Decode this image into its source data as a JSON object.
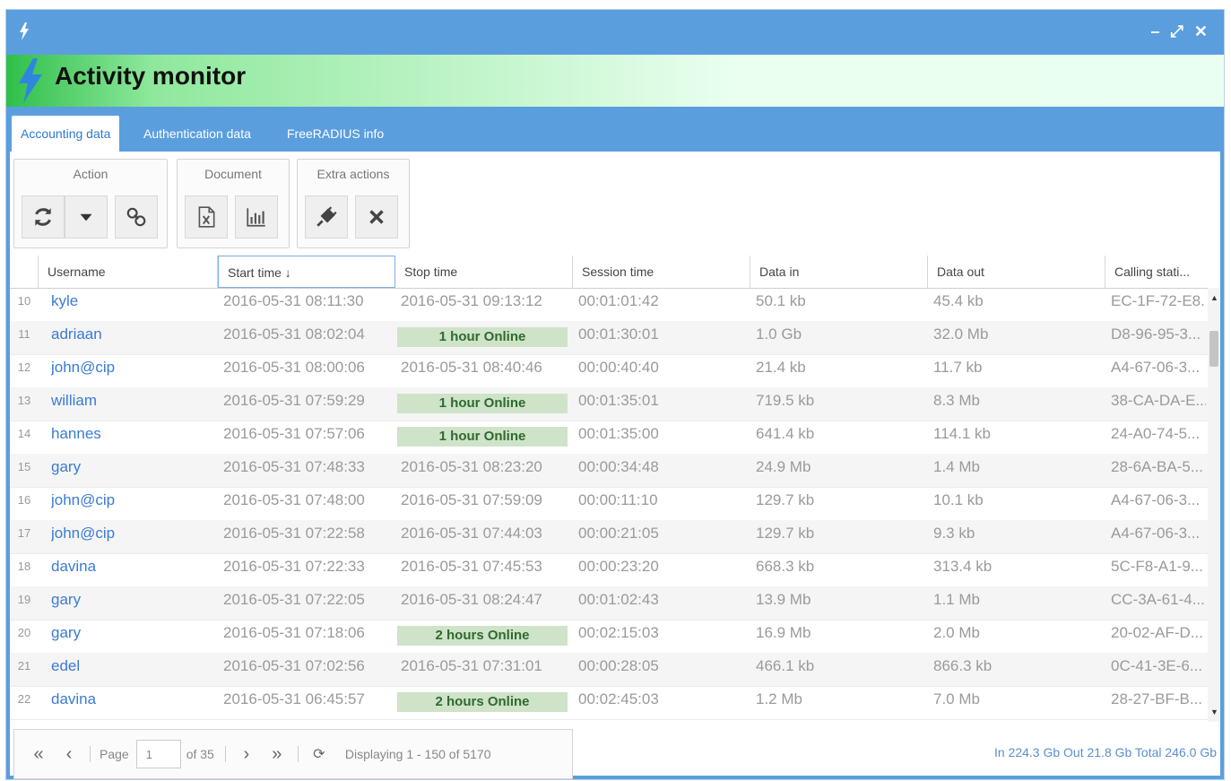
{
  "window": {
    "title": "Activity monitor",
    "controls": [
      "–",
      "⤢",
      "✕"
    ]
  },
  "tabs": [
    {
      "label": "Accounting data",
      "active": true
    },
    {
      "label": "Authentication data",
      "active": false
    },
    {
      "label": "FreeRADIUS info",
      "active": false
    }
  ],
  "toolbar": {
    "action_label": "Action",
    "document_label": "Document",
    "extra_label": "Extra actions"
  },
  "columns": [
    "Username",
    "Start time",
    "Stop time",
    "Session time",
    "Data in",
    "Data out",
    "Calling stati..."
  ],
  "sort_indicator": "↓",
  "rows": [
    {
      "n": "10",
      "user": "kyle",
      "start": "2016-05-31 08:11:30",
      "stop": "2016-05-31 09:13:12",
      "online": "",
      "session": "00:01:01:42",
      "din": "50.1 kb",
      "dout": "45.4 kb",
      "calling": "EC-1F-72-E8..."
    },
    {
      "n": "11",
      "user": "adriaan",
      "start": "2016-05-31 08:02:04",
      "stop": "",
      "online": "1 hour Online",
      "session": "00:01:30:01",
      "din": "1.0 Gb",
      "dout": "32.0 Mb",
      "calling": "D8-96-95-3..."
    },
    {
      "n": "12",
      "user": "john@cip",
      "start": "2016-05-31 08:00:06",
      "stop": "2016-05-31 08:40:46",
      "online": "",
      "session": "00:00:40:40",
      "din": "21.4 kb",
      "dout": "11.7 kb",
      "calling": "A4-67-06-3..."
    },
    {
      "n": "13",
      "user": "william",
      "start": "2016-05-31 07:59:29",
      "stop": "",
      "online": "1 hour Online",
      "session": "00:01:35:01",
      "din": "719.5 kb",
      "dout": "8.3 Mb",
      "calling": "38-CA-DA-E..."
    },
    {
      "n": "14",
      "user": "hannes",
      "start": "2016-05-31 07:57:06",
      "stop": "",
      "online": "1 hour Online",
      "session": "00:01:35:00",
      "din": "641.4 kb",
      "dout": "114.1 kb",
      "calling": "24-A0-74-5..."
    },
    {
      "n": "15",
      "user": "gary",
      "start": "2016-05-31 07:48:33",
      "stop": "2016-05-31 08:23:20",
      "online": "",
      "session": "00:00:34:48",
      "din": "24.9 Mb",
      "dout": "1.4 Mb",
      "calling": "28-6A-BA-5..."
    },
    {
      "n": "16",
      "user": "john@cip",
      "start": "2016-05-31 07:48:00",
      "stop": "2016-05-31 07:59:09",
      "online": "",
      "session": "00:00:11:10",
      "din": "129.7 kb",
      "dout": "10.1 kb",
      "calling": "A4-67-06-3..."
    },
    {
      "n": "17",
      "user": "john@cip",
      "start": "2016-05-31 07:22:58",
      "stop": "2016-05-31 07:44:03",
      "online": "",
      "session": "00:00:21:05",
      "din": "129.7 kb",
      "dout": "9.3 kb",
      "calling": "A4-67-06-3..."
    },
    {
      "n": "18",
      "user": "davina",
      "start": "2016-05-31 07:22:33",
      "stop": "2016-05-31 07:45:53",
      "online": "",
      "session": "00:00:23:20",
      "din": "668.3 kb",
      "dout": "313.4 kb",
      "calling": "5C-F8-A1-9..."
    },
    {
      "n": "19",
      "user": "gary",
      "start": "2016-05-31 07:22:05",
      "stop": "2016-05-31 08:24:47",
      "online": "",
      "session": "00:01:02:43",
      "din": "13.9 Mb",
      "dout": "1.1 Mb",
      "calling": "CC-3A-61-4..."
    },
    {
      "n": "20",
      "user": "gary",
      "start": "2016-05-31 07:18:06",
      "stop": "",
      "online": "2 hours Online",
      "session": "00:02:15:03",
      "din": "16.9 Mb",
      "dout": "2.0 Mb",
      "calling": "20-02-AF-D..."
    },
    {
      "n": "21",
      "user": "edel",
      "start": "2016-05-31 07:02:56",
      "stop": "2016-05-31 07:31:01",
      "online": "",
      "session": "00:00:28:05",
      "din": "466.1 kb",
      "dout": "866.3 kb",
      "calling": "0C-41-3E-6..."
    },
    {
      "n": "22",
      "user": "davina",
      "start": "2016-05-31 06:45:57",
      "stop": "",
      "online": "2 hours Online",
      "session": "00:02:45:03",
      "din": "1.2 Mb",
      "dout": "7.0 Mb",
      "calling": "28-27-BF-B..."
    }
  ],
  "pager": {
    "page_label": "Page",
    "page_value": "1",
    "of_label": "of 35",
    "displaying": "Displaying 1 - 150 of 5170"
  },
  "totals": "In 224.3 Gb Out 21.8 Gb Total 246.0 Gb",
  "colors": {
    "blue": "#5b9ede",
    "online_bg": "#cfe3c9",
    "link": "#3a7bd5"
  }
}
